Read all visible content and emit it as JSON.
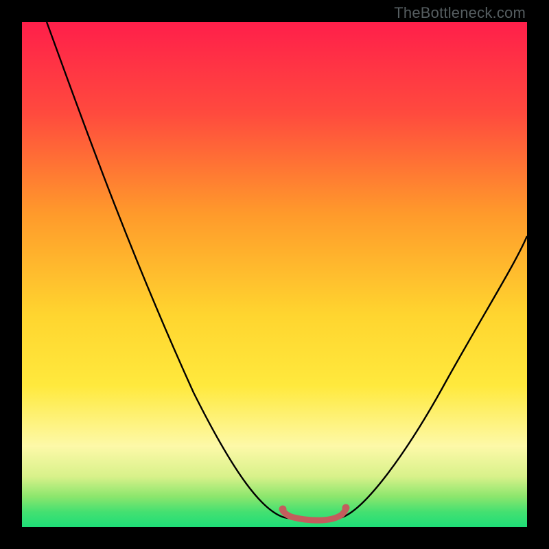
{
  "watermark": "TheBottleneck.com",
  "colors": {
    "top_red": "#ff1f4a",
    "orange": "#ff9a2b",
    "yellow": "#ffe93d",
    "pale_yellow": "#fdf9a8",
    "green_light": "#8be66d",
    "green": "#1ede77",
    "curve": "#000000",
    "marker": "#c35d5d",
    "frame": "#000000"
  },
  "chart_data": {
    "type": "line",
    "title": "",
    "xlabel": "",
    "ylabel": "",
    "xlim": [
      0,
      100
    ],
    "ylim": [
      0,
      100
    ],
    "grid": false,
    "legend": false,
    "series": [
      {
        "name": "bottleneck-curve",
        "x": [
          5,
          10,
          15,
          20,
          25,
          30,
          35,
          40,
          45,
          50,
          52,
          55,
          58,
          60,
          63,
          65,
          70,
          75,
          80,
          85,
          90,
          95,
          100
        ],
        "y": [
          100,
          89,
          78,
          67,
          56,
          45,
          35,
          25,
          16,
          8,
          5,
          2,
          1,
          1,
          2,
          4,
          10,
          18,
          28,
          38,
          47,
          53,
          58
        ]
      },
      {
        "name": "optimal-range-marker",
        "x": [
          52,
          54,
          56,
          58,
          60,
          62,
          64
        ],
        "y": [
          3.0,
          2.2,
          1.8,
          1.6,
          1.6,
          1.9,
          2.7
        ]
      }
    ],
    "annotations": [
      {
        "text": "TheBottleneck.com",
        "role": "watermark",
        "position": "top-right"
      }
    ]
  }
}
